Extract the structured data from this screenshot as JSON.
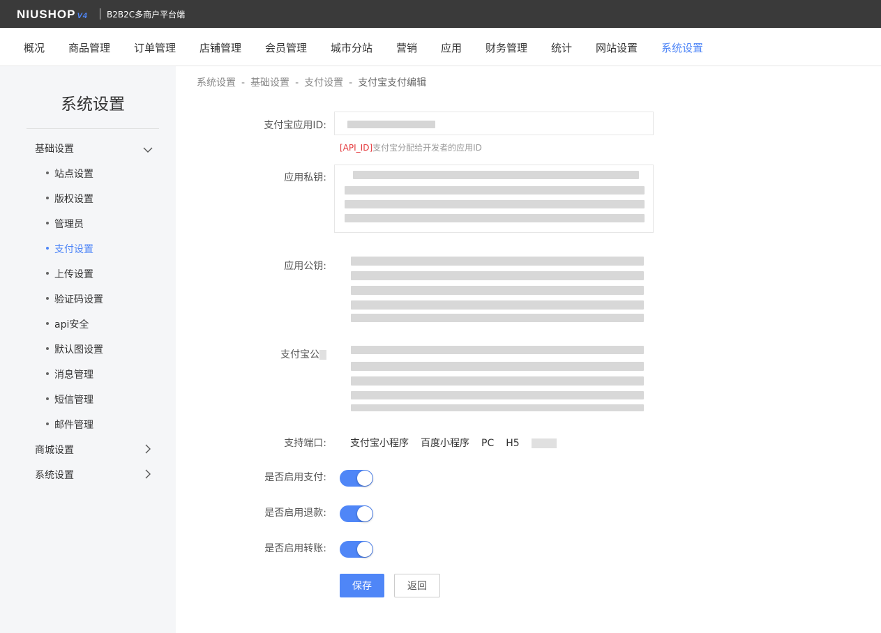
{
  "header": {
    "logo_text": "NIUSHOP",
    "logo_version": "V4",
    "subtitle": "B2B2C多商户平台端"
  },
  "nav": {
    "items": [
      "概况",
      "商品管理",
      "订单管理",
      "店铺管理",
      "会员管理",
      "城市分站",
      "营销",
      "应用",
      "财务管理",
      "统计",
      "网站设置",
      "系统设置"
    ],
    "active_index": 11
  },
  "sidebar": {
    "title": "系统设置",
    "groups": [
      {
        "label": "基础设置",
        "expanded": true
      },
      {
        "label": "商城设置",
        "expanded": false
      },
      {
        "label": "系统设置",
        "expanded": false
      }
    ],
    "sub_items": [
      "站点设置",
      "版权设置",
      "管理员",
      "支付设置",
      "上传设置",
      "验证码设置",
      "api安全",
      "默认图设置",
      "消息管理",
      "短信管理",
      "邮件管理"
    ],
    "active_sub_index": 3
  },
  "breadcrumb": {
    "items": [
      "系统设置",
      "基础设置",
      "支付设置",
      "支付宝支付编辑"
    ],
    "separator": "-"
  },
  "form": {
    "app_id_label": "支付宝应用ID:",
    "app_id_hint_tag": "[API_ID]",
    "app_id_hint_text": "支付宝分配给开发者的应用ID",
    "private_key_label": "应用私钥:",
    "public_key_label": "应用公钥:",
    "alipay_public_key_label": "支付宝公",
    "ports_label": "支持端口:",
    "ports": [
      "支付宝小程序",
      "百度小程序",
      "PC",
      "H5"
    ],
    "enable_pay_label": "是否启用支付:",
    "enable_pay": true,
    "enable_refund_label": "是否启用退款:",
    "enable_refund": true,
    "enable_transfer_label": "是否启用转账:",
    "enable_transfer": true
  },
  "buttons": {
    "save": "保存",
    "back": "返回"
  },
  "colors": {
    "accent": "#4f86f7",
    "topbar": "#3a3a3a",
    "sidebar_bg": "#f5f6f8",
    "hint_red": "#e4393c"
  }
}
